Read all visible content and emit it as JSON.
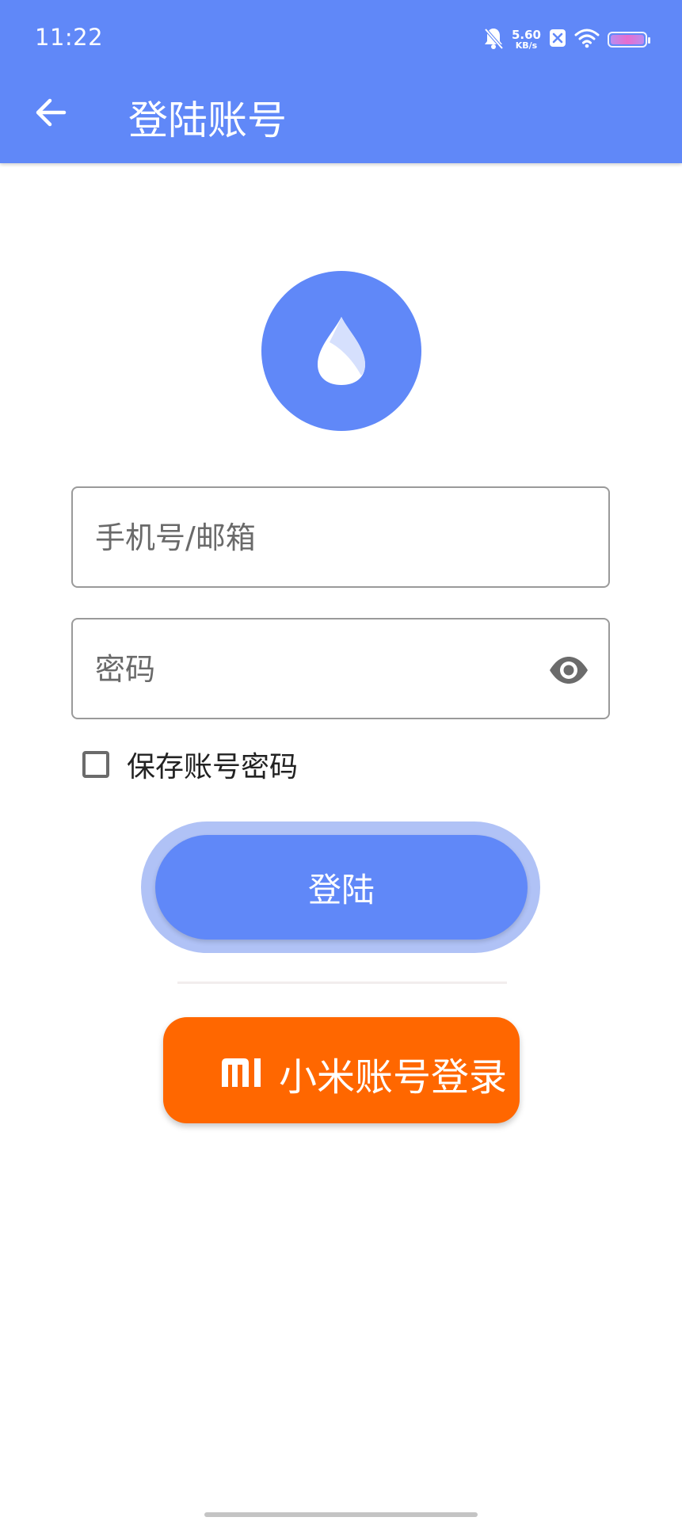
{
  "status_bar": {
    "time": "11:22",
    "net_speed_value": "5.60",
    "net_speed_unit": "KB/s",
    "icons": [
      "bell-off-icon",
      "close-notification-icon",
      "wifi-icon",
      "battery-icon"
    ]
  },
  "app_bar": {
    "back_icon": "arrow-left-icon",
    "title": "登陆账号"
  },
  "logo": {
    "icon": "water-drop-icon"
  },
  "form": {
    "account_placeholder": "手机号/邮箱",
    "account_value": "",
    "password_placeholder": "密码",
    "password_value": "",
    "visibility_icon": "eye-icon",
    "remember_label": "保存账号密码",
    "remember_checked": false,
    "login_label": "登陆"
  },
  "mi_login": {
    "logo_text": "MI",
    "label": "小米账号登录"
  },
  "colors": {
    "primary": "#6088f8",
    "primary_light": "#b0c2f6",
    "mi_orange": "#ff6700"
  }
}
